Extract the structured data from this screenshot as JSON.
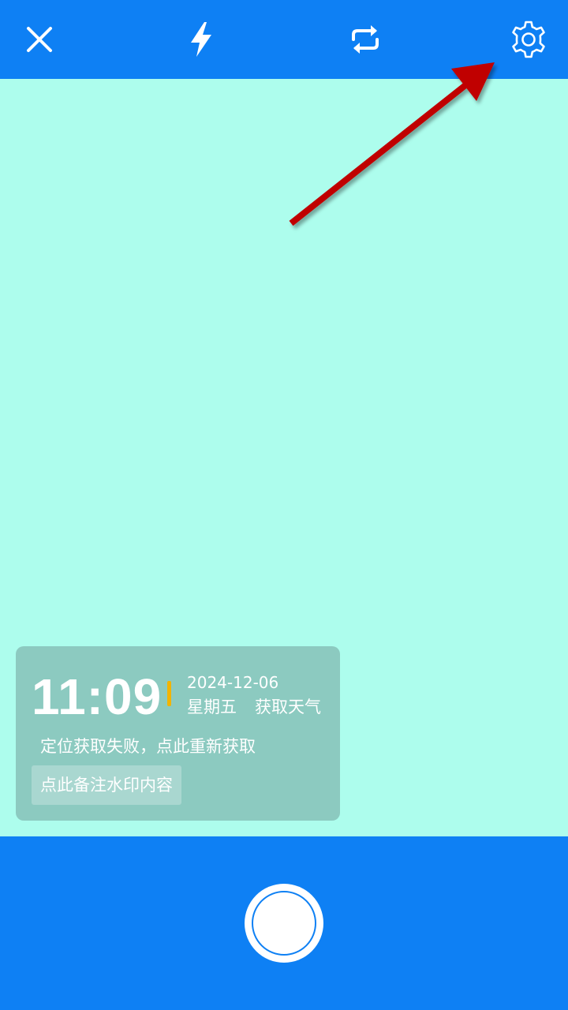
{
  "toolbar": {
    "close_icon": "close-icon",
    "flash_icon": "flash-icon",
    "switch_camera_icon": "switch-camera-icon",
    "settings_icon": "gear-icon"
  },
  "watermark": {
    "time": "11:09",
    "date": "2024-12-06",
    "weekday": "星期五",
    "weather_link": "获取天气",
    "location_message": "定位获取失败，点此重新获取",
    "note_prompt": "点此备注水印内容"
  },
  "colors": {
    "bar_blue": "#0e80f4",
    "preview_background": "#adfded",
    "watermark_background": "#8ccac0",
    "divider_accent": "#f2b400",
    "arrow_red": "#c00000"
  },
  "shutter": {
    "icon": "shutter-button"
  }
}
